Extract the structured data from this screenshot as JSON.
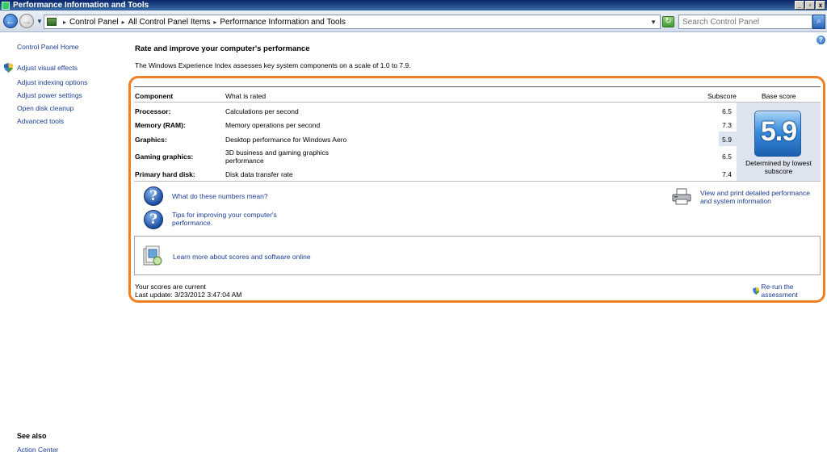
{
  "window": {
    "title": "Performance Information and Tools",
    "controls": {
      "minimize": "_",
      "maximize": "▫",
      "close": "x"
    }
  },
  "address": {
    "crumbs": [
      "Control Panel",
      "All Control Panel Items",
      "Performance Information and Tools"
    ],
    "search_placeholder": "Search Control Panel"
  },
  "sidebar": {
    "home": "Control Panel Home",
    "links": [
      "Adjust visual effects",
      "Adjust indexing options",
      "Adjust power settings",
      "Open disk cleanup",
      "Advanced tools"
    ],
    "see_also_title": "See also",
    "see_also_links": [
      "Action Center"
    ]
  },
  "main": {
    "title": "Rate and improve your computer's performance",
    "description": "The Windows Experience Index assesses key system components on a scale of 1.0 to 7.9.",
    "table": {
      "headers": {
        "component": "Component",
        "rated": "What is rated",
        "subscore": "Subscore",
        "base": "Base score"
      },
      "rows": [
        {
          "component": "Processor:",
          "rated": "Calculations per second",
          "subscore": "6.5"
        },
        {
          "component": "Memory (RAM):",
          "rated": "Memory operations per second",
          "subscore": "7.3"
        },
        {
          "component": "Graphics:",
          "rated": "Desktop performance for Windows Aero",
          "subscore": "5.9"
        },
        {
          "component": "Gaming graphics:",
          "rated": "3D business and gaming graphics performance",
          "subscore": "6.5"
        },
        {
          "component": "Primary hard disk:",
          "rated": "Disk data transfer rate",
          "subscore": "7.4"
        }
      ],
      "base_score": "5.9",
      "base_caption": "Determined by lowest subscore"
    },
    "links": {
      "numbers": "What do these numbers mean?",
      "tips": "Tips for improving your computer's performance.",
      "print": "View and print detailed performance and system information",
      "learn": "Learn more about scores and software online"
    },
    "status": {
      "current": "Your scores are current",
      "last_update": "Last update: 3/23/2012 3:47:04 AM",
      "rerun": "Re-run the assessment"
    }
  },
  "colors": {
    "highlight": "#ef7f22",
    "link": "#1a3d94",
    "score_panel": "#dde4ef"
  }
}
